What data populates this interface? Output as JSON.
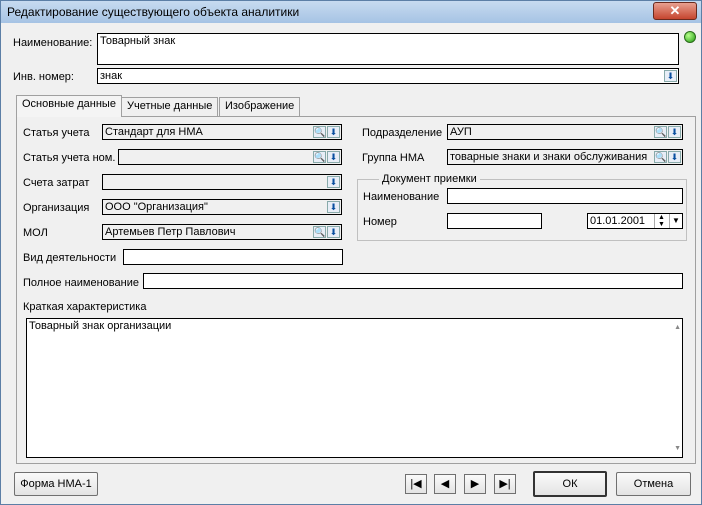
{
  "window": {
    "title": "Редактирование существующего объекта аналитики",
    "close": "✕"
  },
  "header": {
    "name_label": "Наименование:",
    "name_value": "Товарный знак",
    "inv_label": "Инв. номер:",
    "inv_value": "знак"
  },
  "tabs": [
    "Основные данные",
    "Учетные данные",
    "Изображение"
  ],
  "main": {
    "statya_label": "Статья учета",
    "statya_value": "Стандарт для НМА",
    "statya_nom_label": "Статья учета ном.",
    "statya_nom_value": "",
    "scheta_label": "Счета затрат",
    "scheta_value": "",
    "org_label": "Организация",
    "org_value": "ООО \"Организация\"",
    "mol_label": "МОЛ",
    "mol_value": "Артемьев Петр Павлович",
    "vid_label": "Вид деятельности",
    "vid_value": "",
    "podr_label": "Подразделение",
    "podr_value": "АУП",
    "gruppa_label": "Группа НМА",
    "gruppa_value": "товарные знаки и знаки обслуживания",
    "doc_group_title": "Документ приемки",
    "doc_name_label": "Наименование",
    "doc_name_value": "",
    "doc_num_label": "Номер",
    "doc_num_value": "",
    "doc_date_value": "01.01.2001",
    "full_name_label": "Полное наименование",
    "full_name_value": "",
    "brief_label": "Краткая характеристика",
    "brief_value": "Товарный знак организации"
  },
  "footer": {
    "forma_label": "Форма НМА-1",
    "first": "|◀",
    "prev": "◀",
    "next": "▶",
    "last": "▶|",
    "ok_label": "ОК",
    "cancel_label": "Отмена"
  },
  "icons": {
    "search": "🔍",
    "dropdown": "⬇"
  }
}
